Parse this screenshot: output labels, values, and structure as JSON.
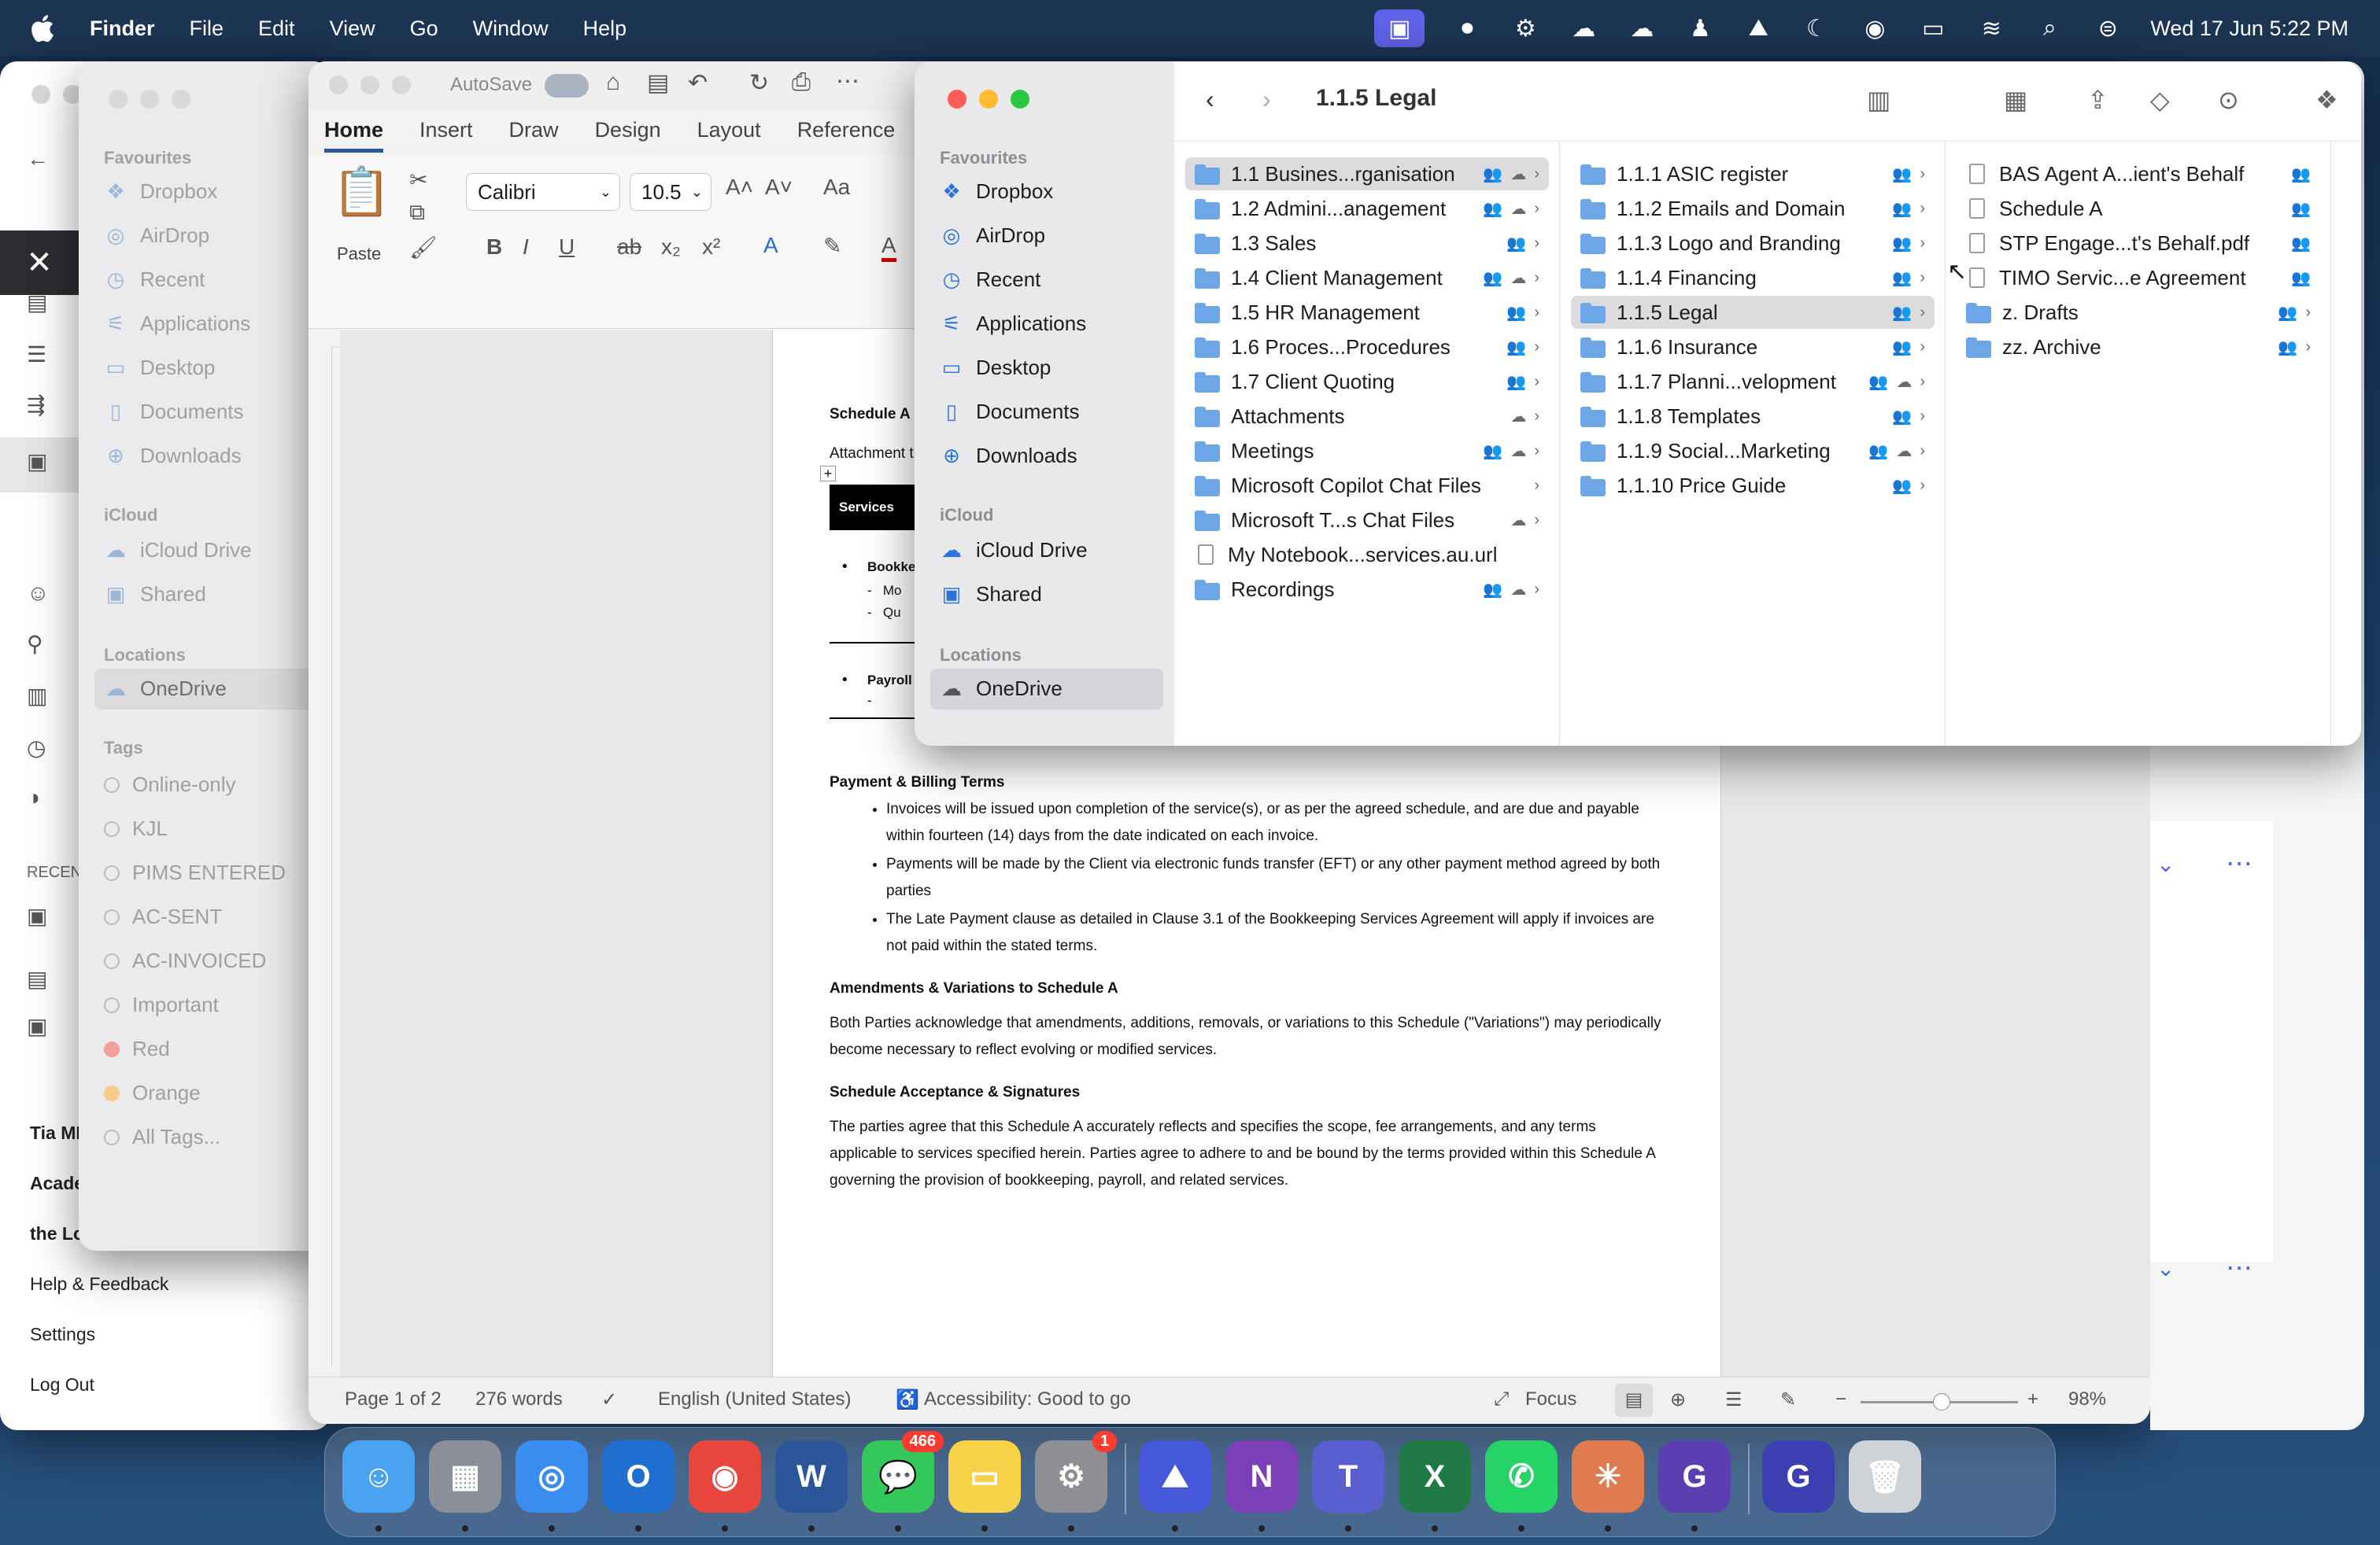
{
  "menubar": {
    "app_name": "Finder",
    "menus": [
      "File",
      "Edit",
      "View",
      "Go",
      "Window",
      "Help"
    ],
    "clock": "Wed 17 Jun  5:22 PM"
  },
  "teams": {
    "bottom_links": [
      "Tia MI",
      "Acade",
      "the Lo",
      "Help & Feedback",
      "Settings",
      "Log Out"
    ],
    "recent_label": "RECENT"
  },
  "finder_back": {
    "favourites_header": "Favourites",
    "favourites": [
      "Dropbox",
      "AirDrop",
      "Recent",
      "Applications",
      "Desktop",
      "Documents",
      "Downloads"
    ],
    "icloud_header": "iCloud",
    "icloud": [
      "iCloud Drive",
      "Shared"
    ],
    "locations_header": "Locations",
    "locations": [
      "OneDrive"
    ],
    "tags_header": "Tags",
    "tags": [
      {
        "label": "Online-only",
        "color": "#ffffff"
      },
      {
        "label": "KJL",
        "color": "#ffffff"
      },
      {
        "label": "PIMS ENTERED",
        "color": "#ffffff"
      },
      {
        "label": "AC-SENT",
        "color": "#ffffff"
      },
      {
        "label": "AC-INVOICED",
        "color": "#ffffff"
      },
      {
        "label": "Important",
        "color": "#ffffff"
      },
      {
        "label": "Red",
        "color": "#ff5f57"
      },
      {
        "label": "Orange",
        "color": "#f5a623"
      },
      {
        "label": "All Tags...",
        "color": "#ffffff"
      }
    ]
  },
  "word": {
    "autosave": "AutoSave",
    "tabs": [
      "Home",
      "Insert",
      "Draw",
      "Design",
      "Layout",
      "Reference"
    ],
    "font_name": "Calibri",
    "font_size": "10.5",
    "paste_label": "Paste",
    "doc": {
      "heading": "Schedule A",
      "attachment": "Attachment t",
      "services_header": "Services",
      "bookkeeping": "Bookke",
      "bk_sub1": "Mo",
      "bk_sub2": "Qu",
      "payroll": "Payroll",
      "payment_title": "Payment & Billing Terms",
      "payment_items": [
        "Invoices will be issued upon completion of the service(s), or as per the agreed schedule, and are due and payable within fourteen (14) days from the date indicated on each invoice.",
        "Payments will be made by the Client via electronic funds transfer (EFT) or any other payment method agreed by both parties",
        "The Late Payment clause as detailed in Clause 3.1 of the Bookkeeping Services Agreement will apply if invoices are not paid within the stated terms."
      ],
      "amend_title": "Amendments & Variations to Schedule A",
      "amend_text": "Both Parties acknowledge that amendments, additions, removals, or variations to this Schedule (\"Variations\") may periodically become necessary to reflect evolving or modified services.",
      "accept_title": "Schedule Acceptance & Signatures",
      "accept_text": "The parties agree that this Schedule A accurately reflects and specifies the scope, fee arrangements, and any terms applicable to services specified herein. Parties agree to adhere to and be bound by the terms provided within this Schedule A governing the provision of bookkeeping, payroll, and related services."
    },
    "status": {
      "page": "Page 1 of 2",
      "words": "276 words",
      "language": "English (United States)",
      "accessibility": "Accessibility: Good to go",
      "focus": "Focus",
      "zoom": "98%"
    }
  },
  "finder": {
    "title": "1.1.5 Legal",
    "favourites_header": "Favourites",
    "favourites": [
      "Dropbox",
      "AirDrop",
      "Recent",
      "Applications",
      "Desktop",
      "Documents",
      "Downloads"
    ],
    "icloud_header": "iCloud",
    "icloud": [
      "iCloud Drive",
      "Shared"
    ],
    "locations_header": "Locations",
    "locations": [
      "OneDrive"
    ],
    "col1": [
      "1.1 Busines...rganisation",
      "1.2 Admini...anagement",
      "1.3 Sales",
      "1.4 Client Management",
      "1.5 HR Management",
      "1.6 Proces...Procedures",
      "1.7 Client Quoting",
      "Attachments",
      "Meetings",
      "Microsoft Copilot Chat Files",
      "Microsoft T...s Chat Files",
      "My Notebook...services.au.url",
      "Recordings"
    ],
    "col2": [
      "1.1.1 ASIC register",
      "1.1.2 Emails and Domain",
      "1.1.3 Logo and Branding",
      "1.1.4 Financing",
      "1.1.5 Legal",
      "1.1.6 Insurance",
      "1.1.7 Planni...velopment",
      "1.1.8 Templates",
      "1.1.9 Social...Marketing",
      "1.1.10 Price Guide"
    ],
    "col3": [
      "BAS Agent A...ient's Behalf",
      "Schedule A",
      "STP Engage...t's Behalf.pdf",
      "TIMO Servic...e Agreement",
      "z. Drafts",
      "zz. Archive"
    ]
  },
  "dock": {
    "apps": [
      "Finder",
      "Launchpad",
      "Safari",
      "Outlook",
      "Chrome",
      "Word",
      "Messages",
      "Notes",
      "System Settings",
      "NordVPN",
      "OneNote",
      "Teams",
      "Excel",
      "WhatsApp",
      "Claude",
      "Grammarly",
      "Grammarly Desktop",
      "Trash"
    ],
    "messages_badge": "466",
    "settings_badge": "1"
  }
}
